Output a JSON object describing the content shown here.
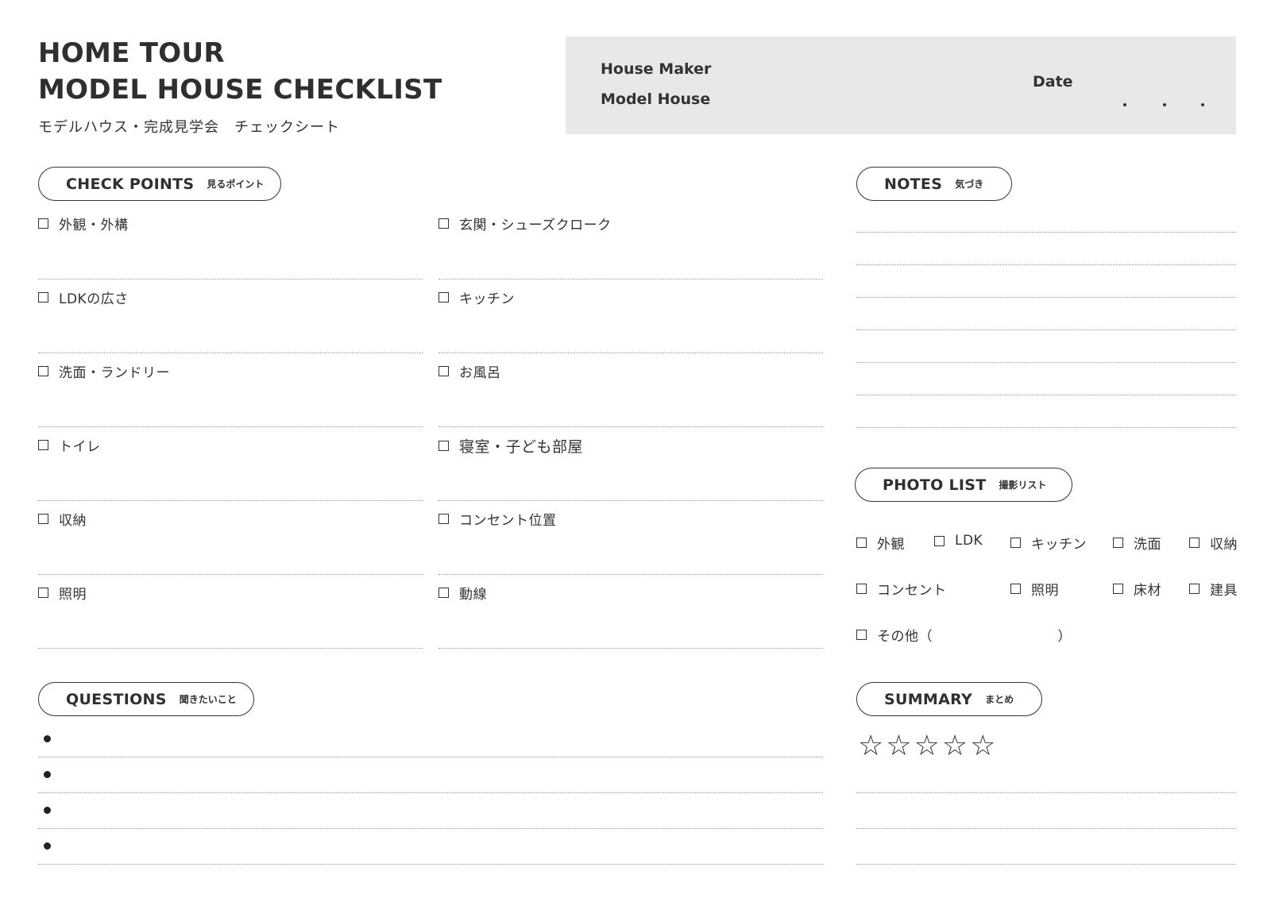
{
  "header": {
    "title_line1": "HOME TOUR",
    "title_line2": "MODEL HOUSE CHECKLIST",
    "subtitle": "モデルハウス・完成見学会　チェックシート",
    "house_maker_label": "House Maker",
    "model_house_label": "Model House",
    "date_label": "Date"
  },
  "check_points": {
    "heading_en": "CHECK POINTS",
    "heading_jp": "見るポイント",
    "left_items": [
      "外観・外構",
      "LDKの広さ",
      "洗面・ランドリー",
      "トイレ",
      "収納",
      "照明"
    ],
    "right_items": [
      "玄関・シューズクローク",
      "キッチン",
      "お風呂",
      "寝室・子ども部屋",
      "コンセント位置",
      "動線"
    ]
  },
  "notes": {
    "heading_en": "NOTES",
    "heading_jp": "気づき"
  },
  "photo_list": {
    "heading_en": "PHOTO LIST",
    "heading_jp": "撮影リスト",
    "items": [
      "外観",
      "LDK",
      "キッチン",
      "洗面",
      "収納",
      "コンセント",
      "照明",
      "床材",
      "建具",
      "その他（　　　　　　　　　）"
    ]
  },
  "questions": {
    "heading_en": "QUESTIONS",
    "heading_jp": "聞きたいこと"
  },
  "summary": {
    "heading_en": "SUMMARY",
    "heading_jp": "まとめ",
    "star_icon": "☆",
    "rating": 0,
    "max_rating": 5
  }
}
